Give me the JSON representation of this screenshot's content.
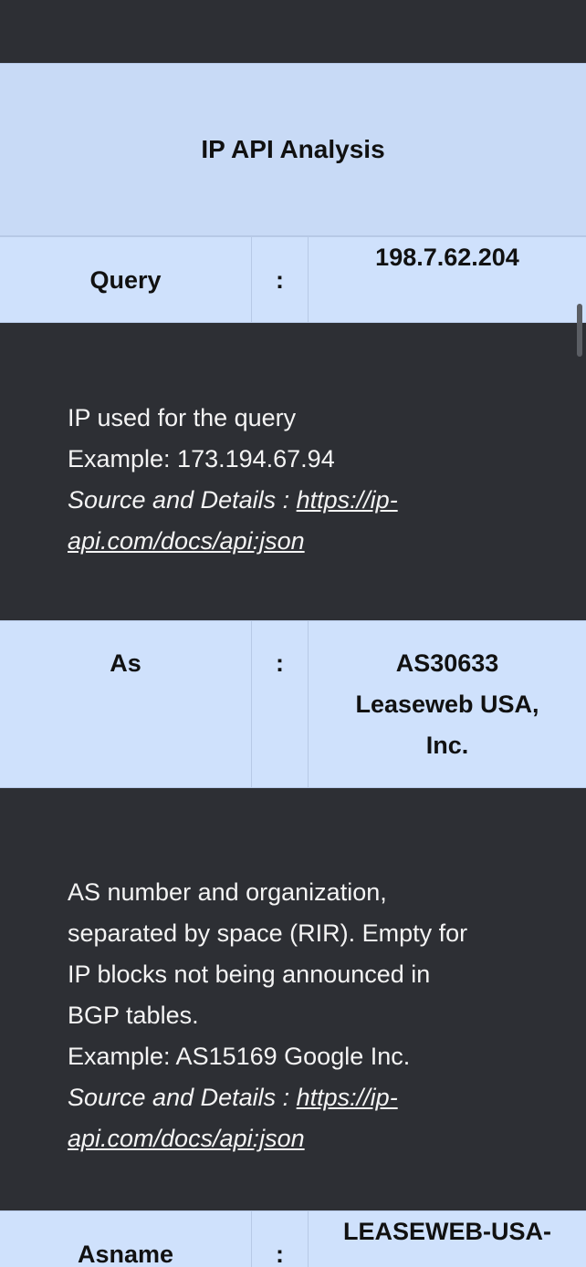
{
  "title": "IP API Analysis",
  "separator": ":",
  "rows": [
    {
      "key": "Query",
      "value_lines": [
        "198.7.62.204"
      ],
      "description_lines": [
        "IP used for the query",
        "Example: 173.194.67.94"
      ],
      "source_label": "Source and Details : ",
      "source_link_lines": [
        "https://ip-",
        "api.com/docs/api:json"
      ]
    },
    {
      "key": "As",
      "value_lines": [
        "AS30633",
        "Leaseweb USA,",
        "Inc."
      ],
      "description_lines": [
        "AS number and organization,",
        "separated by space (RIR). Empty for",
        "IP blocks not being announced in",
        "BGP tables.",
        "Example: AS15169 Google Inc."
      ],
      "source_label": "Source and Details : ",
      "source_link_lines": [
        "https://ip-",
        "api.com/docs/api:json"
      ]
    },
    {
      "key": "Asname",
      "value_lines": [
        "LEASEWEB-USA-"
      ]
    }
  ]
}
